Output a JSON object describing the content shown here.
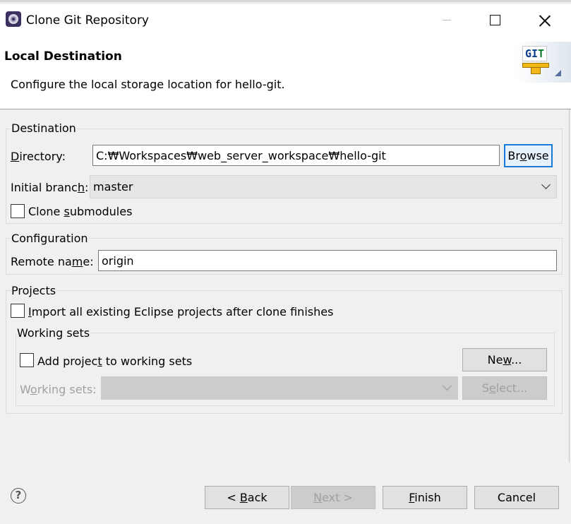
{
  "window": {
    "title": "Clone Git Repository",
    "icon": "eclipse-icon"
  },
  "header": {
    "title": "Local Destination",
    "description": "Configure the local storage location for hello-git.",
    "banner_icon": "git-repository-banner-icon",
    "banner_text_g": "G",
    "banner_text_i": "I",
    "banner_text_t": "T"
  },
  "destination": {
    "group_label": "Destination",
    "directory_label": {
      "pre": "",
      "mn": "D",
      "post": "irectory:"
    },
    "directory_value": "C:₩Workspaces₩web_server_workspace₩hello-git",
    "browse_button": {
      "pre": "Br",
      "mn": "o",
      "post": "wse"
    },
    "branch_label": {
      "pre": "Initial branc",
      "mn": "h",
      "post": ":"
    },
    "branch_value": "master",
    "clone_submodules_label": {
      "pre": "Clone ",
      "mn": "s",
      "post": "ubmodules"
    },
    "clone_submodules_checked": false
  },
  "configuration": {
    "group_label": "Configuration",
    "remote_label": {
      "pre": "Remote na",
      "mn": "m",
      "post": "e:"
    },
    "remote_value": "origin"
  },
  "projects": {
    "group_label": "Projects",
    "import_label": {
      "pre": "",
      "mn": "I",
      "post": "mport all existing Eclipse projects after clone finishes"
    },
    "import_checked": false,
    "working_sets": {
      "group_label": "Working sets",
      "add_label": {
        "pre": "Add projec",
        "mn": "t",
        "post": " to working sets"
      },
      "add_checked": false,
      "new_button": {
        "pre": "Ne",
        "mn": "w",
        "post": "..."
      },
      "sets_label": {
        "pre": "W",
        "mn": "o",
        "post": "rking sets:"
      },
      "sets_value": "",
      "select_button": {
        "pre": "S",
        "mn": "e",
        "post": "lect..."
      }
    }
  },
  "footer": {
    "help_icon": "help-icon",
    "help_glyph": "?",
    "back_button": {
      "pre": "< ",
      "mn": "B",
      "post": "ack"
    },
    "next_button": {
      "pre": "",
      "mn": "N",
      "post": "ext >"
    },
    "finish_button": {
      "pre": "",
      "mn": "F",
      "post": "inish"
    },
    "cancel_button": "Cancel"
  }
}
